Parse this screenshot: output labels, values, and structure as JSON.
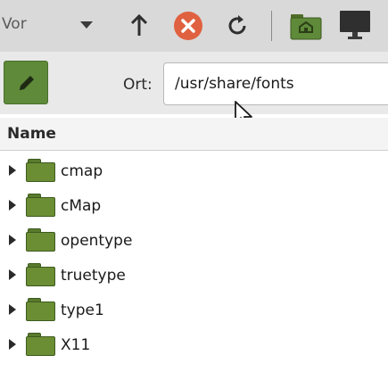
{
  "toolbar": {
    "forward_label": "Vor",
    "icons": {
      "dropdown": "dropdown-arrow-icon",
      "up": "up-arrow-icon",
      "stop": "stop-icon",
      "reload": "reload-icon",
      "home": "home-folder-icon",
      "computer": "computer-icon"
    },
    "colors": {
      "stop": "#e0613f",
      "accent": "#5e8a3a"
    }
  },
  "location": {
    "edit_icon": "pencil-icon",
    "label": "Ort:",
    "path": "/usr/share/fonts"
  },
  "list": {
    "column_header": "Name",
    "items": [
      {
        "label": "cmap"
      },
      {
        "label": "cMap"
      },
      {
        "label": "opentype"
      },
      {
        "label": "truetype"
      },
      {
        "label": "type1"
      },
      {
        "label": "X11"
      }
    ]
  }
}
